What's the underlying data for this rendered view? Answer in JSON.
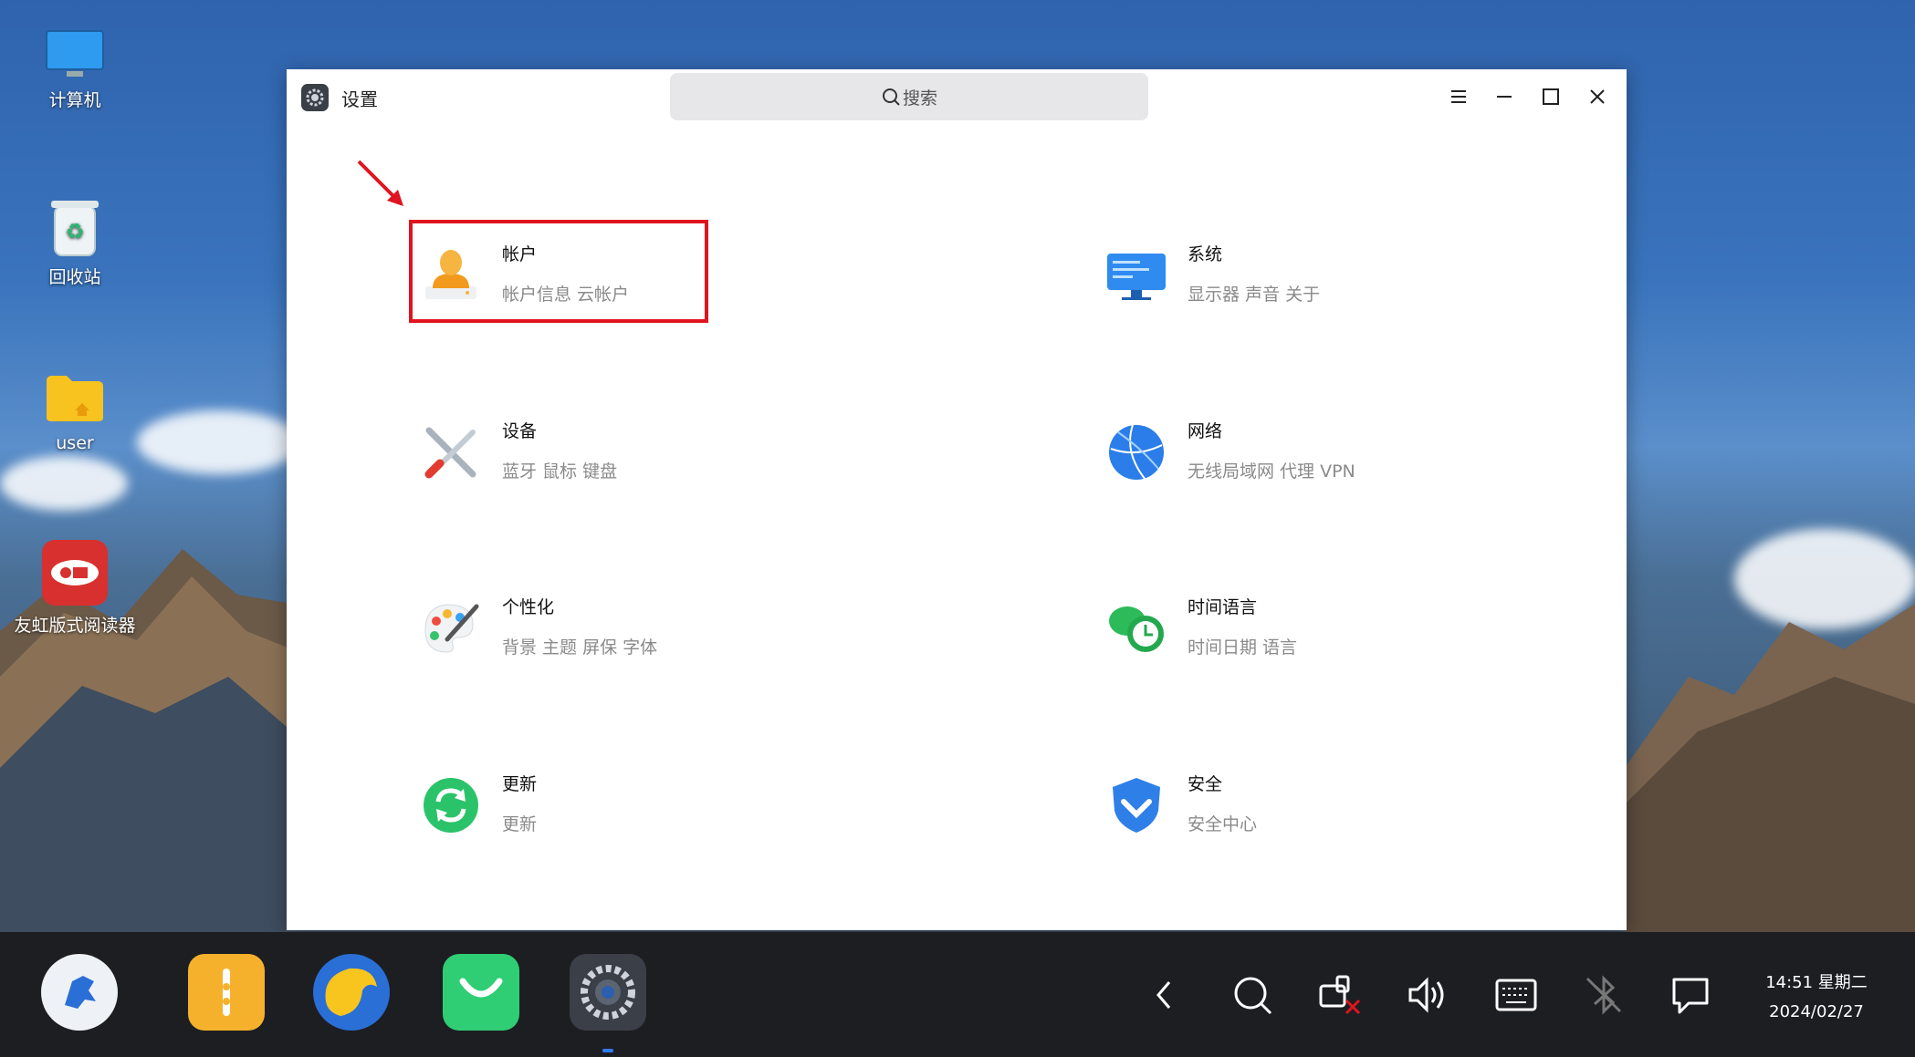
{
  "desktop": {
    "icons": [
      {
        "label": "计算机"
      },
      {
        "label": "回收站"
      },
      {
        "label": "user"
      },
      {
        "label": "友虹版式阅读器"
      }
    ]
  },
  "window": {
    "title": "设置",
    "search_placeholder": "搜索",
    "items": [
      {
        "title": "帐户",
        "subtitle": "帐户信息 云帐户"
      },
      {
        "title": "系统",
        "subtitle": "显示器 声音 关于"
      },
      {
        "title": "设备",
        "subtitle": "蓝牙 鼠标 键盘"
      },
      {
        "title": "网络",
        "subtitle": "无线局域网 代理 VPN"
      },
      {
        "title": "个性化",
        "subtitle": "背景 主题 屏保 字体"
      },
      {
        "title": "时间语言",
        "subtitle": "时间日期 语言"
      },
      {
        "title": "更新",
        "subtitle": "更新"
      },
      {
        "title": "安全",
        "subtitle": "安全中心"
      }
    ]
  },
  "taskbar": {
    "time": "14:51 星期二",
    "date": "2024/02/27"
  },
  "colors": {
    "highlight_box": "#e0141f",
    "taskbar_bg": "#1d1e22",
    "active_indicator": "#2f7cf6"
  }
}
